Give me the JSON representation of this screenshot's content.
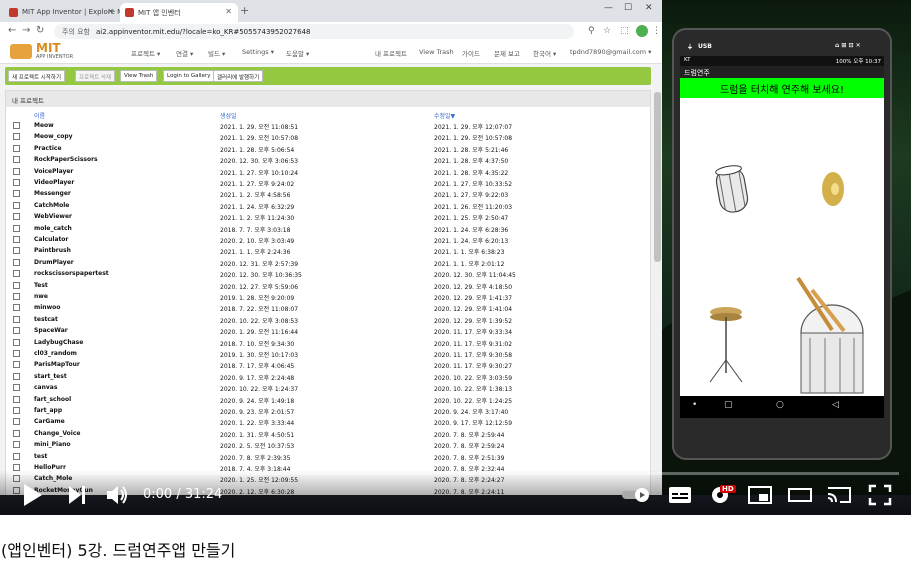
{
  "browser": {
    "tabs": [
      {
        "label": "MIT App Inventor | Explore MIT"
      },
      {
        "label": "MIT 앱 인벤터"
      }
    ],
    "url_security": "주의 요함",
    "url": "ai2.appinventor.mit.edu/?locale=ko_KR#5055743952027648"
  },
  "ai_header": {
    "logo_text": "MIT",
    "logo_sub": "APP INVENTOR",
    "menus": [
      "프로젝트 ▾",
      "연결 ▾",
      "빌드 ▾",
      "Settings ▾",
      "도움말 ▾"
    ],
    "right_links": [
      "내 프로젝트",
      "View Trash",
      "가이드",
      "문제 보고",
      "한국어 ▾",
      "tpdnd7890@gmail.com ▾"
    ]
  },
  "toolbar": {
    "buttons": [
      "새 프로젝트 시작하기",
      "프로젝트 삭제",
      "View Trash",
      "Login to Gallery",
      "갤러리에 발행하기"
    ]
  },
  "projects": {
    "title": "내 프로젝트",
    "headers": {
      "name": "이름",
      "created": "생성일",
      "modified": "수정일▼"
    },
    "rows": [
      [
        "Meow",
        "2021. 1. 29. 오전 11:08:51",
        "2021. 1. 29. 오후 12:07:07"
      ],
      [
        "Meow_copy",
        "2021. 1. 29. 오전 10:57:08",
        "2021. 1. 29. 오전 10:57:08"
      ],
      [
        "Practice",
        "2021. 1. 28. 오후 5:06:54",
        "2021. 1. 28. 오후 5:21:46"
      ],
      [
        "RockPaperScissors",
        "2020. 12. 30. 오후 3:06:53",
        "2021. 1. 28. 오후 4:37:50"
      ],
      [
        "VoicePlayer",
        "2021. 1. 27. 오후 10:10:24",
        "2021. 1. 28. 오후 4:35:22"
      ],
      [
        "VideoPlayer",
        "2021. 1. 27. 오후 9:24:02",
        "2021. 1. 27. 오후 10:33:52"
      ],
      [
        "Messenger",
        "2021. 1. 2. 오후 4:58:56",
        "2021. 1. 27. 오후 9:22:03"
      ],
      [
        "CatchMole",
        "2021. 1. 24. 오후 6:32:29",
        "2021. 1. 26. 오전 11:20:03"
      ],
      [
        "WebViewer",
        "2021. 1. 2. 오후 11:24:30",
        "2021. 1. 25. 오후 2:50:47"
      ],
      [
        "mole_catch",
        "2018. 7. 7. 오후 3:03:18",
        "2021. 1. 24. 오후 6:28:36"
      ],
      [
        "Calculator",
        "2020. 2. 10. 오후 3:03:49",
        "2021. 1. 24. 오후 6:20:13"
      ],
      [
        "Paintbrush",
        "2021. 1. 1. 오후 2:24:36",
        "2021. 1. 1. 오후 6:38:23"
      ],
      [
        "DrumPlayer",
        "2020. 12. 31. 오후 2:57:39",
        "2021. 1. 1. 오후 2:01:12"
      ],
      [
        "rockscissorspapertest",
        "2020. 12. 30. 오후 10:36:35",
        "2020. 12. 30. 오후 11:04:45"
      ],
      [
        "Test",
        "2020. 12. 27. 오후 5:59:06",
        "2020. 12. 29. 오후 4:18:50"
      ],
      [
        "nwe",
        "2019. 1. 28. 오전 9:20:09",
        "2020. 12. 29. 오후 1:41:37"
      ],
      [
        "minwoo",
        "2018. 7. 22. 오전 11:08:07",
        "2020. 12. 29. 오후 1:41:04"
      ],
      [
        "testcat",
        "2020. 10. 22. 오후 3:08:53",
        "2020. 12. 29. 오후 1:39:52"
      ],
      [
        "SpaceWar",
        "2020. 1. 29. 오전 11:16:44",
        "2020. 11. 17. 오후 9:33:34"
      ],
      [
        "LadybugChase",
        "2018. 7. 10. 오전 9:34:30",
        "2020. 11. 17. 오후 9:31:02"
      ],
      [
        "cl03_random",
        "2019. 1. 30. 오전 10:17:03",
        "2020. 11. 17. 오후 9:30:58"
      ],
      [
        "ParisMapTour",
        "2018. 7. 17. 오후 4:06:45",
        "2020. 11. 17. 오후 9:30:27"
      ],
      [
        "start_test",
        "2020. 9. 17. 오후 2:24:48",
        "2020. 10. 22. 오후 3:03:59"
      ],
      [
        "canvas",
        "2020. 10. 22. 오후 1:24:37",
        "2020. 10. 22. 오후 1:38:13"
      ],
      [
        "fart_school",
        "2020. 9. 24. 오후 1:49:18",
        "2020. 10. 22. 오후 1:24:25"
      ],
      [
        "fart_app",
        "2020. 9. 23. 오후 2:01:57",
        "2020. 9. 24. 오후 3:17:40"
      ],
      [
        "CarGame",
        "2020. 1. 22. 오후 3:33:44",
        "2020. 9. 17. 오후 12:12:59"
      ],
      [
        "Change_Voice",
        "2020. 1. 31. 오후 4:50:51",
        "2020. 7. 8. 오후 2:59:44"
      ],
      [
        "mini_Piano",
        "2020. 2. 5. 오전 10:37:53",
        "2020. 7. 8. 오후 2:59:24"
      ],
      [
        "test",
        "2020. 7. 8. 오후 2:39:35",
        "2020. 7. 8. 오후 2:51:39"
      ],
      [
        "HelloPurr",
        "2018. 7. 4. 오후 3:18:44",
        "2020. 7. 8. 오후 2:32:44"
      ],
      [
        "Catch_Mole",
        "2020. 1. 25. 오전 12:09:55",
        "2020. 7. 8. 오후 2:24:27"
      ],
      [
        "RocketMoneyGun",
        "2020. 2. 12. 오후 6:30:28",
        "2020. 7. 8. 오후 2:24:11"
      ]
    ]
  },
  "phone": {
    "usb_label": "USB",
    "status_left": "KT",
    "status_right": "100% 오후 10:37",
    "app_title": "드럼연주",
    "banner": "드럼을 터치해 연주해 보세요!"
  },
  "player": {
    "time": "0:00 / 31:24",
    "progress": 0,
    "hd_badge": "HD"
  },
  "video_title": "(앱인벤터) 5강. 드럼연주앱 만들기",
  "colors": {
    "toolbar_green": "#93c840",
    "banner_green": "#00ff00",
    "header_link": "#3366cc",
    "hd_red": "#cc0000"
  }
}
